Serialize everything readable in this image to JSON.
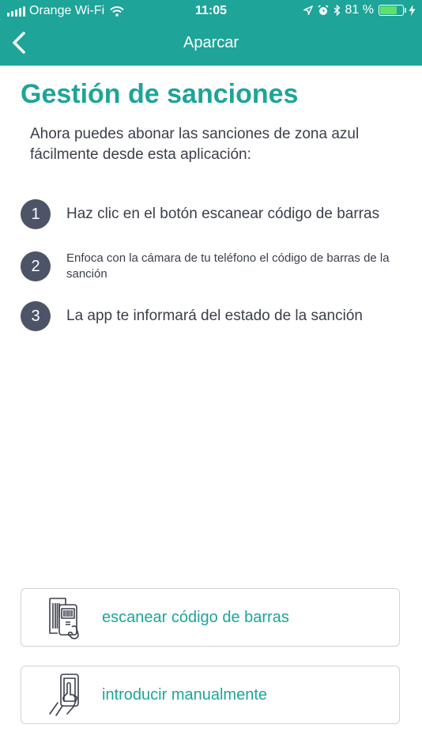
{
  "status_bar": {
    "carrier": "Orange Wi-Fi",
    "time": "11:05",
    "battery_percent": "81 %",
    "battery_level": 0.81,
    "icons": [
      "signal-bars-icon",
      "wifi-icon",
      "location-arrow-icon",
      "alarm-icon",
      "bluetooth-icon",
      "battery-icon",
      "charging-bolt-icon"
    ]
  },
  "navbar": {
    "title": "Aparcar",
    "back_icon": "chevron-left-icon"
  },
  "main": {
    "title": "Gestión de sanciones",
    "intro": "Ahora puedes abonar las sanciones de zona azul fácilmente desde esta aplicación:",
    "steps": [
      {
        "number": "1",
        "text": "Haz clic en el botón escanear código de barras"
      },
      {
        "number": "2",
        "text": "Enfoca con la cámara de tu teléfono el código de barras de la sanción"
      },
      {
        "number": "3",
        "text": "La app te informará del estado de la sanción"
      }
    ]
  },
  "actions": {
    "scan": {
      "label": "escanear código de barras",
      "icon": "barcode-scan-icon"
    },
    "manual": {
      "label": "introducir manualmente",
      "icon": "hand-touch-phone-icon"
    }
  },
  "colors": {
    "accent": "#1ea498",
    "step_circle": "#4d5468",
    "text": "#3b3f4b",
    "battery_fill": "#5ee06a"
  }
}
